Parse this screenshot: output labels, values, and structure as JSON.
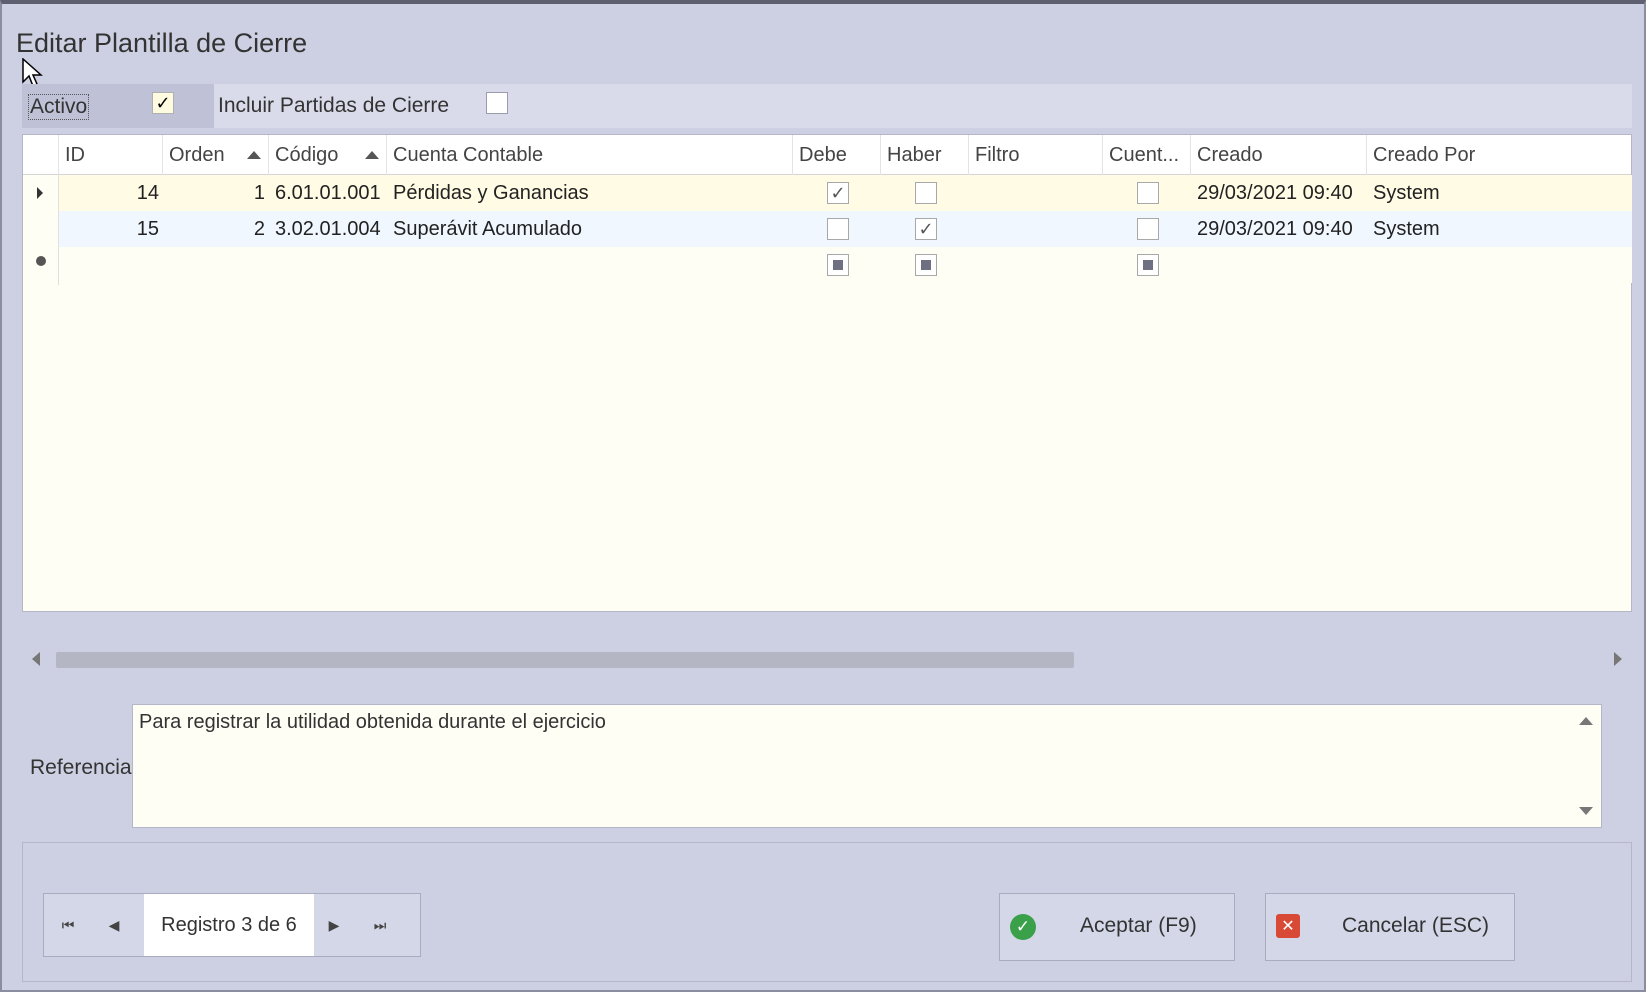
{
  "window": {
    "title": "Editar Plantilla de Cierre"
  },
  "options": {
    "activo_label": "Activo",
    "activo_checked": true,
    "incluir_label": "Incluir Partidas de Cierre",
    "incluir_checked": false
  },
  "grid": {
    "columns": [
      "ID",
      "Orden",
      "Código",
      "Cuenta Contable",
      "Debe",
      "Haber",
      "Filtro",
      "Cuent...",
      "Creado",
      "Creado Por"
    ],
    "rows": [
      {
        "id": "14",
        "orden": "1",
        "codigo": "6.01.01.001",
        "cuenta": "Pérdidas y Ganancias",
        "debe": true,
        "haber": false,
        "filtro": "",
        "cuenta_flag": false,
        "creado": "29/03/2021 09:40",
        "creado_por": "System"
      },
      {
        "id": "15",
        "orden": "2",
        "codigo": "3.02.01.004",
        "cuenta": "Superávit Acumulado",
        "debe": false,
        "haber": true,
        "filtro": "",
        "cuenta_flag": false,
        "creado": "29/03/2021 09:40",
        "creado_por": "System"
      }
    ]
  },
  "referencia": {
    "label": "Referencia",
    "value": "Para registrar la utilidad obtenida durante el ejercicio"
  },
  "navigator": {
    "text": "Registro 3 de 6"
  },
  "buttons": {
    "accept_label": "Aceptar (F9)",
    "cancel_label": "Cancelar (ESC)"
  },
  "icons": {
    "first": "first-record-icon",
    "prev": "prev-record-icon",
    "next": "next-record-icon",
    "last": "last-record-icon",
    "accept": "check-circle-icon",
    "cancel": "close-box-icon"
  }
}
